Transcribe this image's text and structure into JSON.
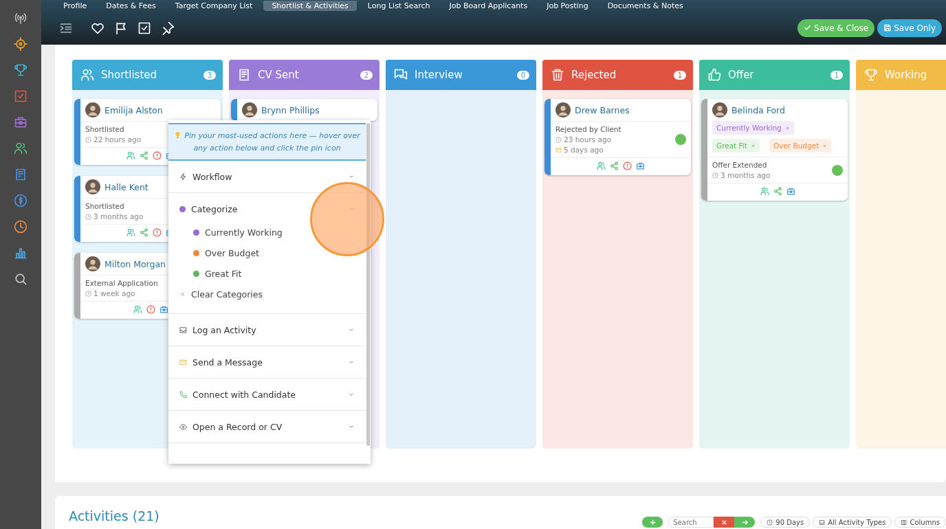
{
  "top_tabs": [
    {
      "label": "Profile",
      "selected": false
    },
    {
      "label": "Dates & Fees",
      "selected": false
    },
    {
      "label": "Target Company List",
      "selected": false
    },
    {
      "label": "Shortlist & Activities",
      "selected": true
    },
    {
      "label": "Long List Search",
      "selected": false
    },
    {
      "label": "Job Board Applicants",
      "selected": false
    },
    {
      "label": "Job Posting",
      "selected": false
    },
    {
      "label": "Documents & Notes",
      "selected": false
    }
  ],
  "header_buttons": [
    {
      "label": "Save & Close",
      "kind": "save_close"
    },
    {
      "label": "Save Only",
      "kind": "save_only"
    }
  ],
  "columns": [
    {
      "title": "Shortlisted",
      "kind": "people",
      "count": "3",
      "color": "#3eaad6",
      "cards": [
        {
          "name": "Emilija Alston",
          "color": "#3a8fd8",
          "status": "Shortlisted",
          "time": "22 hours ago",
          "actions": [
            {
              "kind": "people"
            },
            {
              "kind": "share"
            },
            {
              "kind": "alert"
            },
            {
              "kind": "briefcase"
            }
          ]
        },
        {
          "name": "Halle Kent",
          "color": "#3a8fd8",
          "status": "Shortlisted",
          "time": "3 months ago",
          "actions": [
            {
              "kind": "people"
            },
            {
              "kind": "share"
            },
            {
              "kind": "alert"
            },
            {
              "kind": "briefcase"
            }
          ]
        },
        {
          "name": "Milton Morgan",
          "color": "#aaaaaa",
          "status": "External Application",
          "time": "1 week ago",
          "actions": [
            {
              "kind": "people"
            },
            {
              "kind": "alert"
            },
            {
              "kind": "briefcase"
            }
          ]
        }
      ]
    },
    {
      "title": "CV Sent",
      "kind": "document",
      "count": "2",
      "color": "#9a7bd8",
      "cards": [
        {
          "name": "Brynn Phillips",
          "color": "#3a8fd8"
        }
      ]
    },
    {
      "title": "Interview",
      "kind": "chat",
      "count": "0",
      "color": "#3a97d8"
    },
    {
      "title": "Rejected",
      "kind": "trash",
      "count": "1",
      "color": "#df5441",
      "cards": [
        {
          "name": "Drew Barnes",
          "color": "#3a8fd8",
          "status": "Rejected by Client",
          "time": "23 hours ago",
          "mail_time": "5 days ago",
          "online": true,
          "actions": [
            {
              "kind": "people"
            },
            {
              "kind": "share"
            },
            {
              "kind": "alert"
            },
            {
              "kind": "briefcase"
            }
          ]
        }
      ]
    },
    {
      "title": "Offer",
      "kind": "thumb",
      "count": "1",
      "color": "#3cbd9c",
      "cards": [
        {
          "name": "Belinda Ford",
          "color": "#aaaaaa",
          "tags": [
            {
              "label": "Currently Working",
              "color": "#9b6ad6"
            },
            {
              "label": "Great Fit",
              "color": "#5cb85c"
            },
            {
              "label": "Over Budget",
              "color": "#ee8a3c"
            }
          ],
          "status": "Offer Extended",
          "time": "3 months ago",
          "online": true,
          "actions": [
            {
              "kind": "people"
            },
            {
              "kind": "share"
            },
            {
              "kind": "briefcase"
            }
          ]
        }
      ]
    },
    {
      "title": "Working",
      "kind": "trophy",
      "color": "#f2bb45"
    }
  ],
  "action_menu": {
    "hint": "Pin your most-used actions here — hover over any action below and click the pin icon",
    "sections": [
      {
        "label": "Workflow",
        "kind": "bolt",
        "expanded": false
      },
      {
        "label": "Categorize",
        "kind": "dot",
        "expanded": true,
        "options": [
          {
            "label": "Currently Working",
            "color": "#9b6ad6"
          },
          {
            "label": "Over Budget",
            "color": "#ee8a3c"
          },
          {
            "label": "Great Fit",
            "color": "#5cb85c"
          }
        ],
        "clear_label": "Clear Categories"
      },
      {
        "label": "Log an Activity",
        "kind": "inbox",
        "expanded": false
      },
      {
        "label": "Send a Message",
        "kind": "mail",
        "expanded": false
      },
      {
        "label": "Connect with Candidate",
        "kind": "phone",
        "expanded": false
      },
      {
        "label": "Open a Record or CV",
        "kind": "eye",
        "expanded": false
      }
    ]
  },
  "activities": {
    "title": "Activities (21)",
    "search": {
      "placeholder": "Search"
    },
    "filters": [
      {
        "label": "90 Days",
        "kind": "clock"
      },
      {
        "label": "All Activity Types",
        "kind": "inbox"
      },
      {
        "label": "Columns",
        "kind": "columns"
      }
    ]
  }
}
